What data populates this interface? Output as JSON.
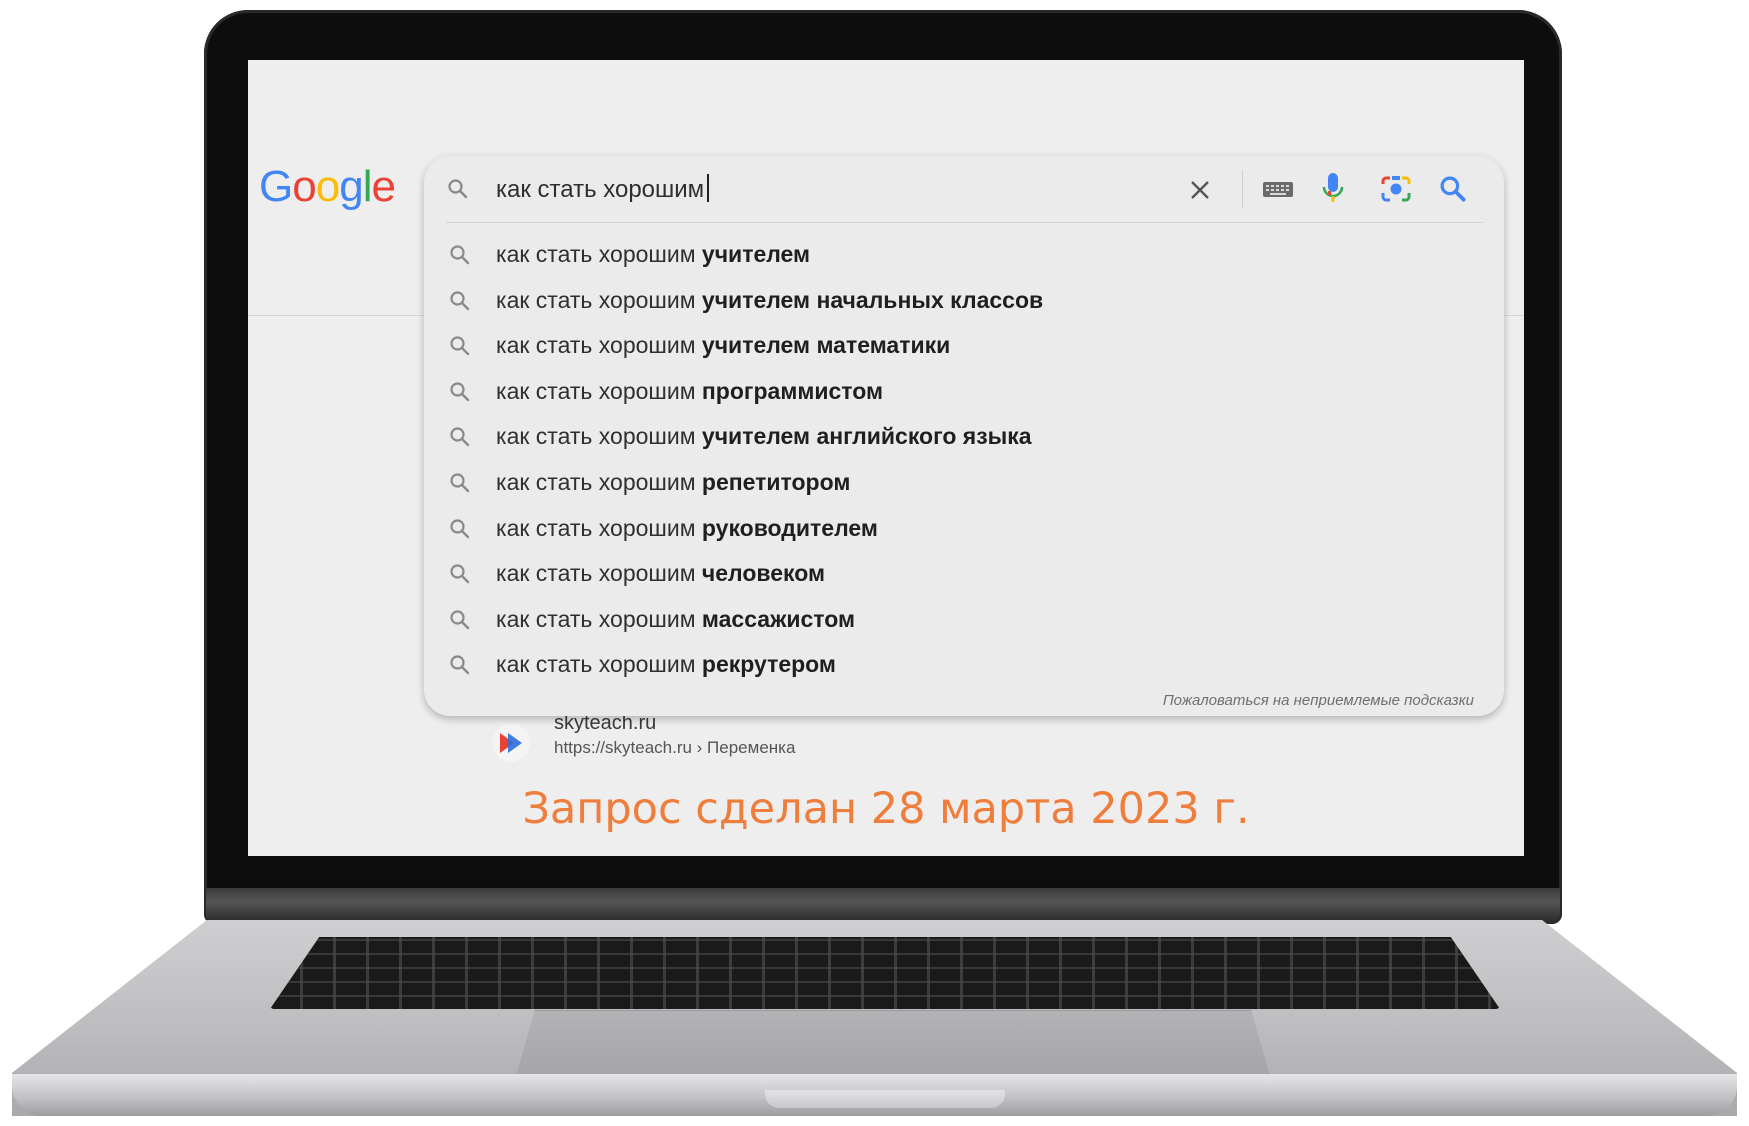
{
  "logo": {
    "letters": [
      "G",
      "o",
      "o",
      "g",
      "l",
      "e"
    ]
  },
  "search": {
    "query": "как стать хорошим",
    "suggestions": [
      {
        "prefix": "как стать хорошим",
        "completion": "учителем"
      },
      {
        "prefix": "как стать хорошим",
        "completion": "учителем начальных классов"
      },
      {
        "prefix": "как стать хорошим",
        "completion": "учителем математики"
      },
      {
        "prefix": "как стать хорошим",
        "completion": "программистом"
      },
      {
        "prefix": "как стать хорошим",
        "completion": "учителем английского языка"
      },
      {
        "prefix": "как стать хорошим",
        "completion": "репетитором"
      },
      {
        "prefix": "как стать хорошим",
        "completion": "руководителем"
      },
      {
        "prefix": "как стать хорошим",
        "completion": "человеком"
      },
      {
        "prefix": "как стать хорошим",
        "completion": "массажистом"
      },
      {
        "prefix": "как стать хорошим",
        "completion": "рекрутером"
      }
    ],
    "report_link": "Пожаловаться на неприемлемые подсказки"
  },
  "result": {
    "site_name": "skyteach.ru",
    "breadcrumb": "https://skyteach.ru › Переменка"
  },
  "caption": "Запрос сделан 28 марта 2023 г.",
  "icons": {
    "search": "search-icon",
    "clear": "close-icon",
    "keyboard": "keyboard-icon",
    "voice": "microphone-icon",
    "lens": "camera-icon",
    "submit": "search-icon"
  },
  "colors": {
    "google_blue": "#4285f4",
    "google_red": "#ea4335",
    "google_yellow": "#fbbc05",
    "google_green": "#34a853",
    "caption": "#ef7d3c"
  }
}
